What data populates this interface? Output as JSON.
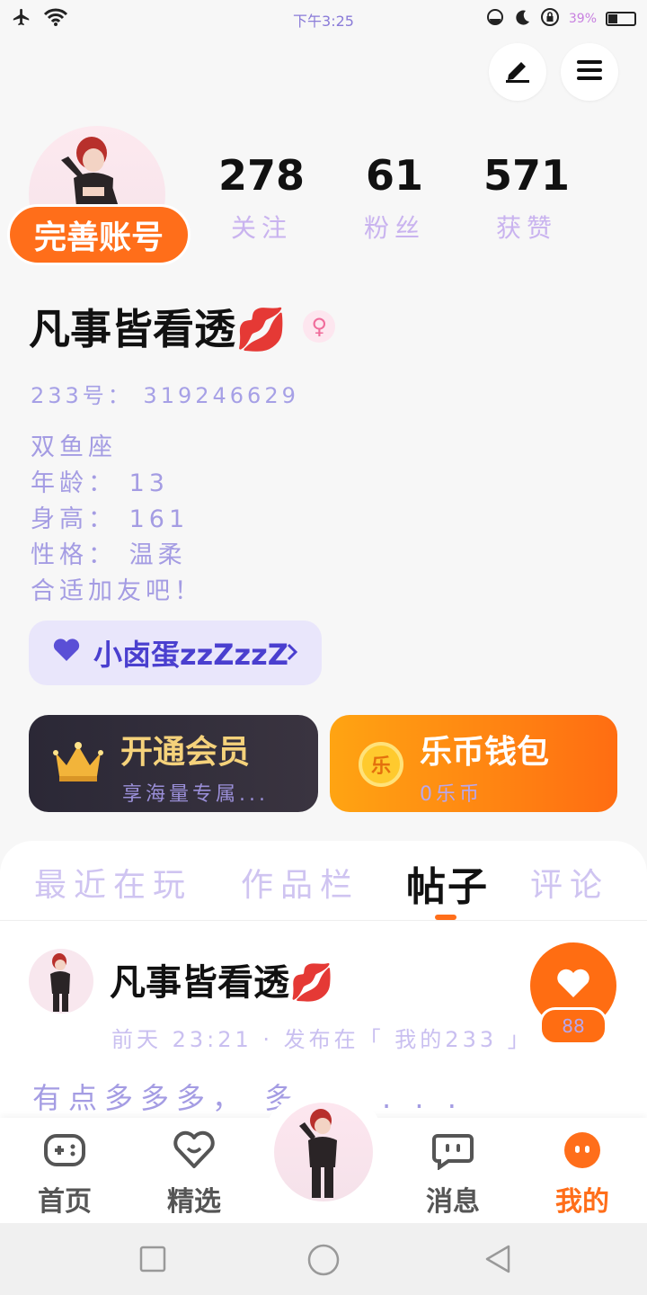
{
  "status_bar": {
    "time": "下午3:25",
    "battery_pct": "39%"
  },
  "header": {
    "edit_icon": "pencil-icon",
    "menu_icon": "menu-icon"
  },
  "profile": {
    "complete_account_label": "完善账号",
    "stats": [
      {
        "value": "278",
        "label": "关注"
      },
      {
        "value": "61",
        "label": "粉丝"
      },
      {
        "value": "571",
        "label": "获赞"
      }
    ],
    "nickname": "凡事皆看透💋",
    "gender_symbol": "♀",
    "id_line": "233号： 319246629",
    "bio_lines": [
      "双鱼座",
      "年龄： 13",
      "身高： 161",
      "性格： 温柔",
      "合适加友吧！"
    ],
    "badge_label": "小卤蛋zzZzzZ"
  },
  "cards": {
    "vip": {
      "title": "开通会员",
      "subtitle": "享海量专属..."
    },
    "wallet": {
      "title": "乐币钱包",
      "subtitle": "0乐币",
      "coin_glyph": "乐"
    }
  },
  "tabs": [
    {
      "label": "最近在玩",
      "active": false
    },
    {
      "label": "作品栏",
      "active": false
    },
    {
      "label": "帖子",
      "active": true
    },
    {
      "label": "评论",
      "active": false
    }
  ],
  "post": {
    "author": "凡事皆看透💋",
    "meta": "前天 23:21 · 发布在「 我的233 」",
    "text": "有点多多多， 多 . . . . .",
    "like_count": "88"
  },
  "bottom_nav": [
    {
      "label": "首页",
      "icon": "gamepad-icon",
      "active": false
    },
    {
      "label": "精选",
      "icon": "heart-face-icon",
      "active": false
    },
    {
      "label": "消息",
      "icon": "chat-icon",
      "active": false
    },
    {
      "label": "我的",
      "icon": "profile-icon",
      "active": true
    }
  ],
  "colors": {
    "accent": "#ff6e1a",
    "badge_bg": "#e9e6fb",
    "vip_gold": "#f5d27b"
  }
}
